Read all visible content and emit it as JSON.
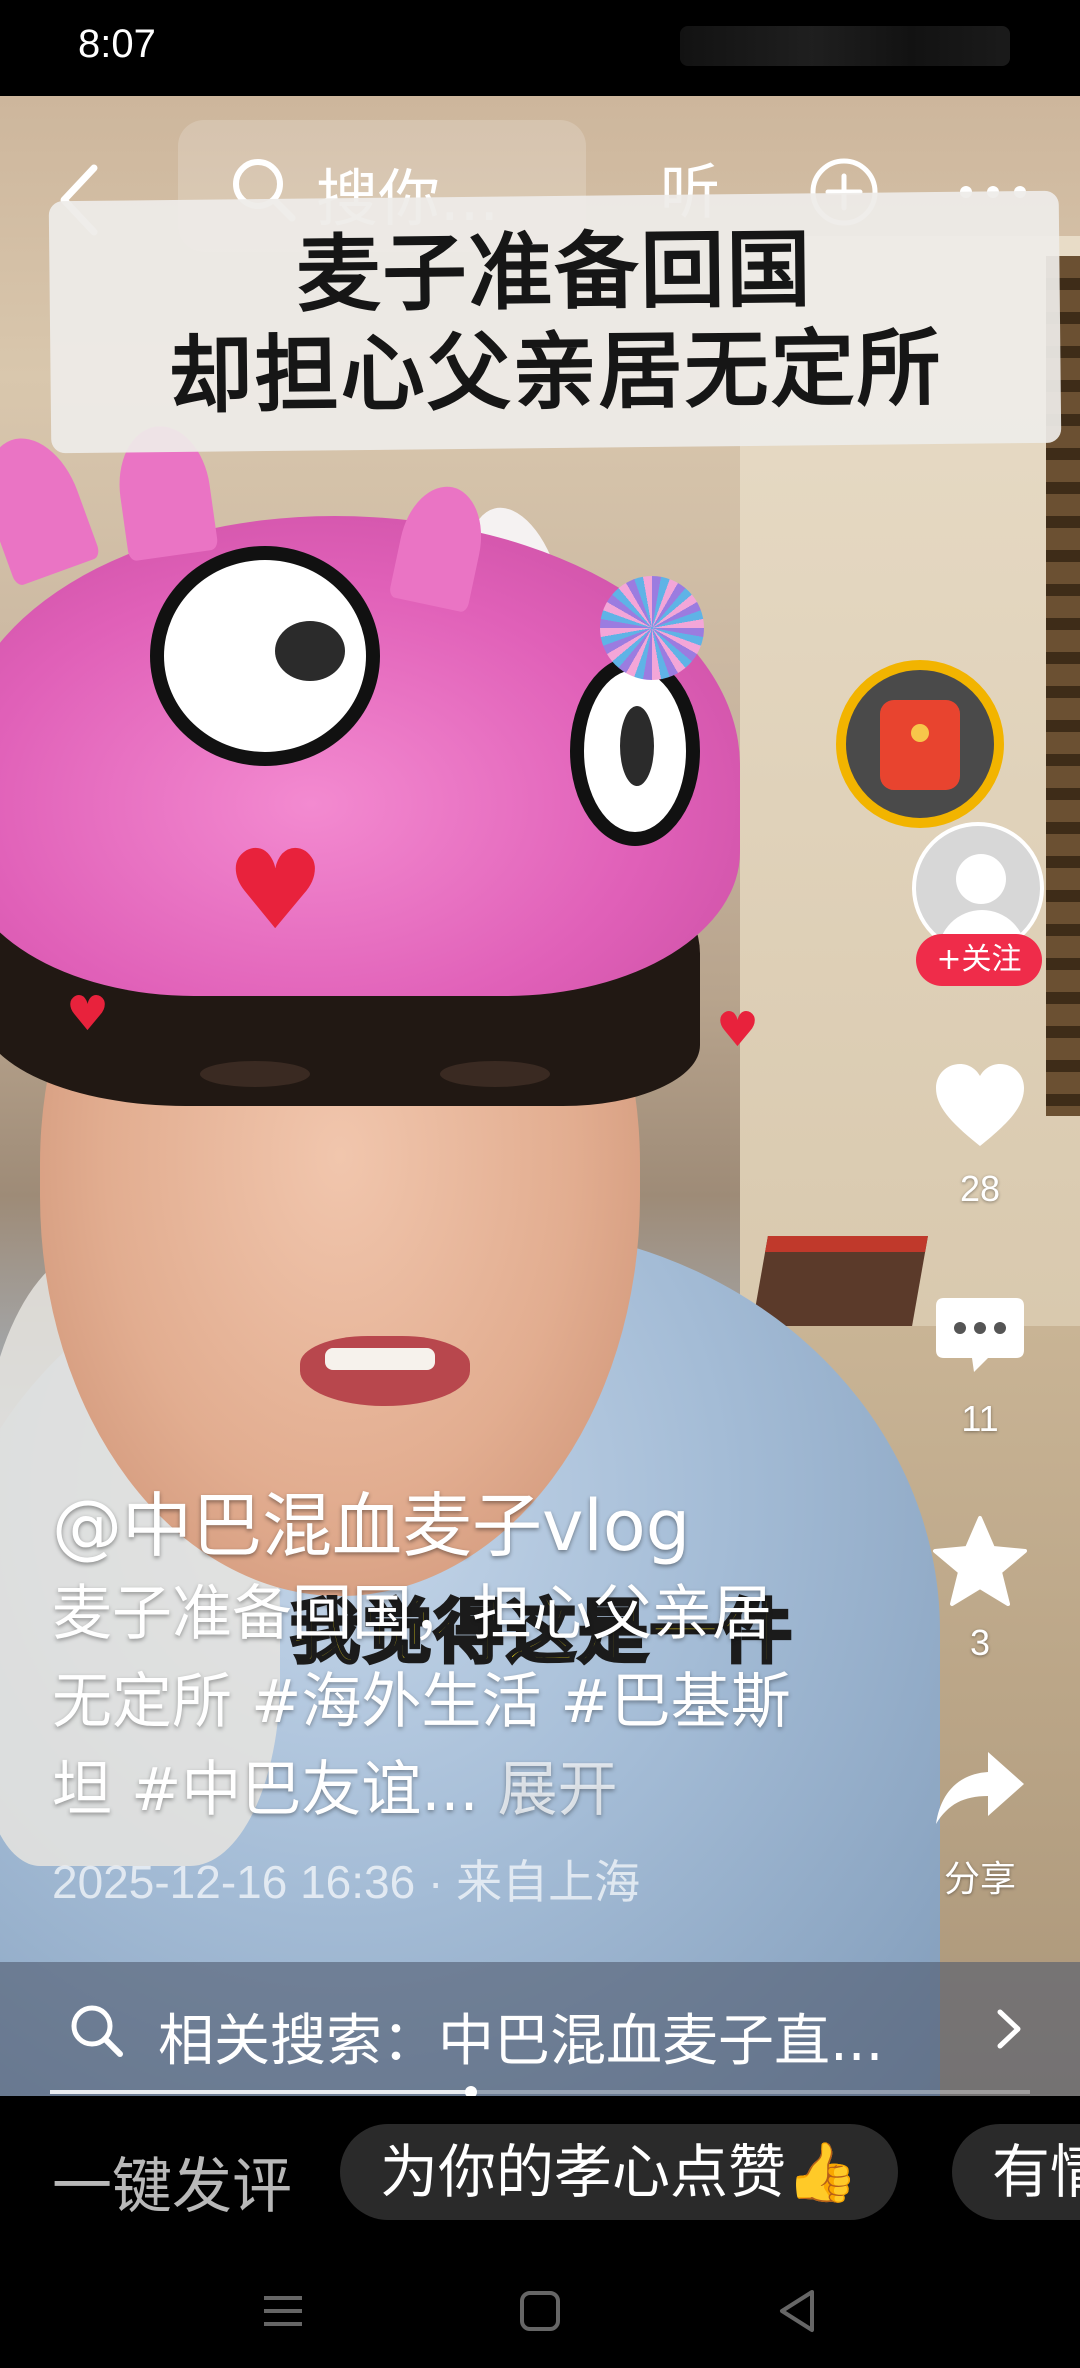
{
  "status_bar": {
    "time": "8:07"
  },
  "top_bar": {
    "search_text": "搜你...",
    "listen_label": "听"
  },
  "banner": {
    "line1": "麦子准备回国",
    "line2": "却担心父亲居无定所"
  },
  "video_caption": "我觉得这是一件",
  "side_actions": {
    "follow_label": "+关注",
    "like_count": "28",
    "comment_count": "11",
    "favorite_count": "3",
    "share_label": "分享"
  },
  "post": {
    "author": "@中巴混血麦子vlog",
    "description": "麦子准备回国，担心父亲居无定所 #海外生活 #巴基斯坦 #中巴友谊...",
    "expand_label": "展开",
    "meta": "2025-12-16 16:36 · 来自上海"
  },
  "related_search": {
    "text": "相关搜索：中巴混血麦子直..."
  },
  "progress": {
    "fraction": 0.43
  },
  "comment_bar": {
    "quick_label": "一键发评",
    "chips": [
      "为你的孝心点赞👍",
      "有情有义"
    ]
  },
  "colors": {
    "accent_red": "#ef2c4a",
    "gold_ring": "#f2b400",
    "caption_yellow": "#f6e01b"
  },
  "icons": [
    "back-icon",
    "search-icon",
    "plus-circle-icon",
    "more-icon",
    "red-packet-icon",
    "heart-icon",
    "comment-icon",
    "star-icon",
    "share-icon",
    "chevron-right-icon"
  ]
}
